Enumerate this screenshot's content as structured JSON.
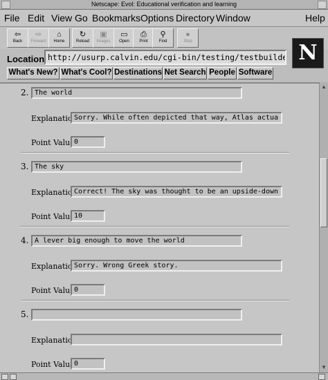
{
  "window": {
    "title": "Netscape: Evol: Educational verification and learning"
  },
  "menu": [
    "File",
    "Edit",
    "View",
    "Go",
    "Bookmarks",
    "Options",
    "Directory",
    "Window",
    "Help"
  ],
  "toolbar": [
    {
      "label": "Back",
      "icon": "back-arrow-icon",
      "glyph": "⇦",
      "enabled": true
    },
    {
      "label": "Forward",
      "icon": "forward-arrow-icon",
      "glyph": "⇨",
      "enabled": false
    },
    {
      "label": "Home",
      "icon": "home-icon",
      "glyph": "⌂",
      "enabled": true
    },
    {
      "label": "Reload",
      "icon": "reload-icon",
      "glyph": "↻",
      "enabled": true
    },
    {
      "label": "Images",
      "icon": "images-icon",
      "glyph": "▣",
      "enabled": false
    },
    {
      "label": "Open",
      "icon": "open-icon",
      "glyph": "▭",
      "enabled": true
    },
    {
      "label": "Print",
      "icon": "print-icon",
      "glyph": "⎙",
      "enabled": true
    },
    {
      "label": "Find",
      "icon": "find-icon",
      "glyph": "⚲",
      "enabled": true
    },
    {
      "label": "Stop",
      "icon": "stop-icon",
      "glyph": "●",
      "enabled": false
    }
  ],
  "location": {
    "label": "Location:",
    "value": "http://usurp.calvin.edu/cgi-bin/testing/testbuilder/"
  },
  "logo": {
    "letter": "N"
  },
  "directory_buttons": [
    "What's New?",
    "What's Cool?",
    "Destinations",
    "Net Search",
    "People",
    "Software"
  ],
  "form": {
    "explanation_label": "Explanation:",
    "point_label": "Point Value:",
    "questions": [
      {
        "number": "2.",
        "answer": "The world",
        "explanation": "Sorry.  While often depicted that way, Atlas actua",
        "points": "0"
      },
      {
        "number": "3.",
        "answer": "The sky",
        "explanation": "Correct!  The sky was thought to be an upside-down",
        "points": "10"
      },
      {
        "number": "4.",
        "answer": "A lever big enough to move the world",
        "explanation": "Sorry.  Wrong Greek story.",
        "points": "0"
      },
      {
        "number": "5.",
        "answer": "",
        "explanation": "",
        "points": "0"
      }
    ]
  }
}
